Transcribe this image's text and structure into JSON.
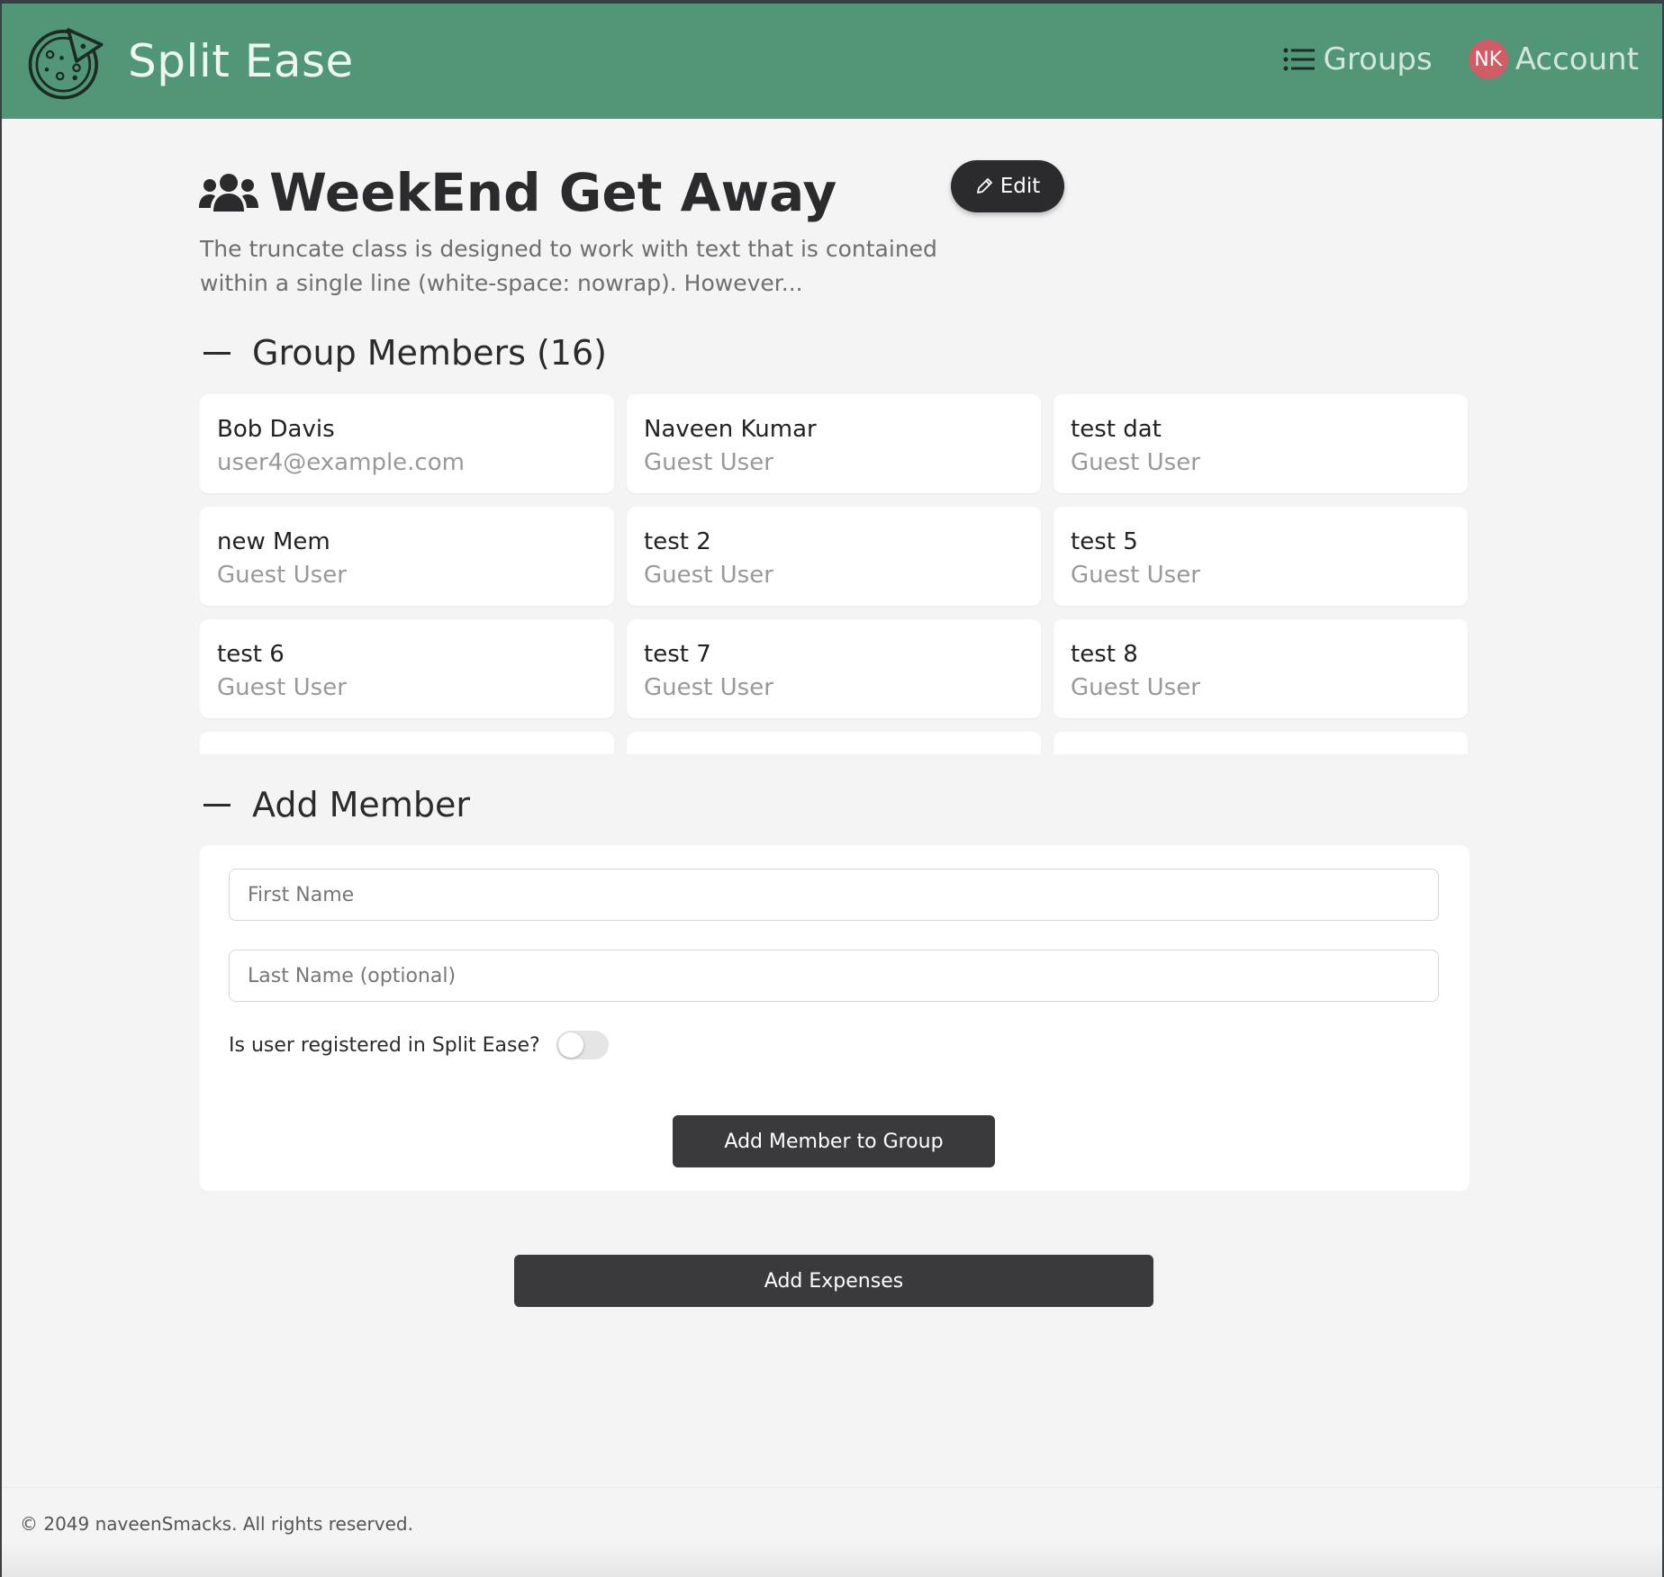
{
  "app": {
    "name": "Split Ease",
    "brand_color": "#519677"
  },
  "nav": {
    "groups_label": "Groups",
    "account_label": "Account",
    "avatar_initials": "NK",
    "avatar_color": "#d05c66"
  },
  "group": {
    "title": "WeekEnd Get Away",
    "edit_label": "Edit",
    "description": "The truncate class is designed to work with text that is contained within a single line (white-space: nowrap). However..."
  },
  "members": {
    "title": "Group Members (16)",
    "items": [
      {
        "name": "Bob Davis",
        "sub": "user4@example.com"
      },
      {
        "name": "Naveen Kumar",
        "sub": "Guest User"
      },
      {
        "name": "test dat",
        "sub": "Guest User"
      },
      {
        "name": "new Mem",
        "sub": "Guest User"
      },
      {
        "name": "test 2",
        "sub": "Guest User"
      },
      {
        "name": "test 5",
        "sub": "Guest User"
      },
      {
        "name": "test 6",
        "sub": "Guest User"
      },
      {
        "name": "test 7",
        "sub": "Guest User"
      },
      {
        "name": "test 8",
        "sub": "Guest User"
      },
      {
        "name": "",
        "sub": ""
      },
      {
        "name": "",
        "sub": ""
      },
      {
        "name": "",
        "sub": ""
      }
    ]
  },
  "add_member": {
    "title": "Add Member",
    "first_name_placeholder": "First Name",
    "last_name_placeholder": "Last Name (optional)",
    "registered_label": "Is user registered in Split Ease?",
    "registered_on": false,
    "submit_label": "Add Member to Group"
  },
  "actions": {
    "add_expenses_label": "Add Expenses"
  },
  "footer": {
    "text": "© 2049 naveenSmacks. All rights reserved."
  }
}
